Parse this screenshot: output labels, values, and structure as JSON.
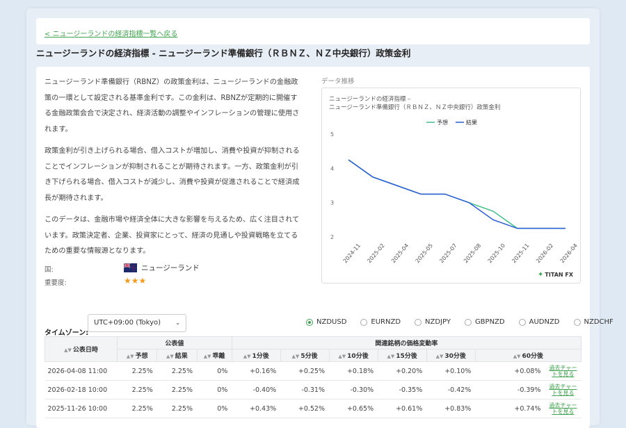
{
  "back_link": "< ニュージーランドの経済指標一覧へ戻る",
  "page_title": "ニュージーランドの経済指標 - ニュージーランド準備銀行（ＲＢＮＺ、ＮＺ中央銀行）政策金利",
  "description": [
    "ニュージーランド準備銀行（RBNZ）の政策金利は、ニュージーランドの金融政策の一環として設定される基準金利です。この金利は、RBNZが定期的に開催する金融政策会合で決定され、経済活動の調整やインフレーションの管理に使用されます。",
    "政策金利が引き上げられる場合、借入コストが増加し、消費や投資が抑制されることでインフレーションが抑制されることが期待されます。一方、政策金利が引き下げられる場合、借入コストが減少し、消費や投資が促進されることで経済成長が期待されます。",
    "このデータは、金融市場や経済全体に大きな影響を与えるため、広く注目されています。政策決定者、企業、投資家にとって、経済の見通しや投資戦略を立てるための重要な情報源となります。"
  ],
  "meta": {
    "country_label": "国:",
    "country_value": "ニュージーランド",
    "importance_label": "重要度:",
    "importance_stars": "★★★"
  },
  "chart_section_label": "データ推移",
  "chart_data": {
    "type": "line",
    "title": "ニュージーランドの経済指標 –\nニュージーランド準備銀行（ＲＢＮＺ、ＮＺ中央銀行）政策金利",
    "categories": [
      "2024-11",
      "2025-02",
      "2025-04",
      "2025-05",
      "2025-07",
      "2025-08",
      "2025-10",
      "2025-11",
      "2026-02",
      "2026-04"
    ],
    "series": [
      {
        "name": "予想",
        "color": "#3cc08a",
        "values": [
          4.25,
          3.75,
          3.5,
          3.25,
          3.25,
          3.0,
          2.75,
          2.25,
          2.25,
          2.25
        ]
      },
      {
        "name": "結果",
        "color": "#2a5bd7",
        "values": [
          4.25,
          3.75,
          3.5,
          3.25,
          3.25,
          3.0,
          2.5,
          2.25,
          2.25,
          2.25
        ]
      }
    ],
    "yticks": [
      2,
      3,
      4,
      5
    ],
    "ylim": [
      2,
      5
    ],
    "legend_position": "top-center"
  },
  "brand": "TITAN FX",
  "timezone": {
    "label": "タイムゾーン:",
    "value": "UTC+09:00 (Tokyo)"
  },
  "pairs": [
    {
      "label": "NZDUSD",
      "selected": true
    },
    {
      "label": "EURNZD",
      "selected": false
    },
    {
      "label": "NZDJPY",
      "selected": false
    },
    {
      "label": "GBPNZD",
      "selected": false
    },
    {
      "label": "AUDNZD",
      "selected": false
    },
    {
      "label": "NZDCHF",
      "selected": false
    }
  ],
  "table": {
    "group_headers": {
      "date": "公表日時",
      "published": "公表値",
      "rate": "関連銘柄の価格変動率"
    },
    "sub_headers": [
      "予想",
      "結果",
      "乖離",
      "1分後",
      "5分後",
      "10分後",
      "15分後",
      "30分後",
      "60分後"
    ],
    "link_label": "過去チャートを見る",
    "rows": [
      {
        "date": "2026-04-08 11:00",
        "forecast": "2.25%",
        "actual": "2.25%",
        "gap": "0%",
        "changes": [
          "+0.16%",
          "+0.25%",
          "+0.18%",
          "+0.20%",
          "+0.10%",
          "+0.08%"
        ]
      },
      {
        "date": "2026-02-18 10:00",
        "forecast": "2.25%",
        "actual": "2.25%",
        "gap": "0%",
        "changes": [
          "-0.40%",
          "-0.31%",
          "-0.30%",
          "-0.35%",
          "-0.42%",
          "-0.39%"
        ]
      },
      {
        "date": "2025-11-26 10:00",
        "forecast": "2.25%",
        "actual": "2.25%",
        "gap": "0%",
        "changes": [
          "+0.43%",
          "+0.52%",
          "+0.65%",
          "+0.61%",
          "+0.83%",
          "+0.74%"
        ]
      }
    ]
  }
}
